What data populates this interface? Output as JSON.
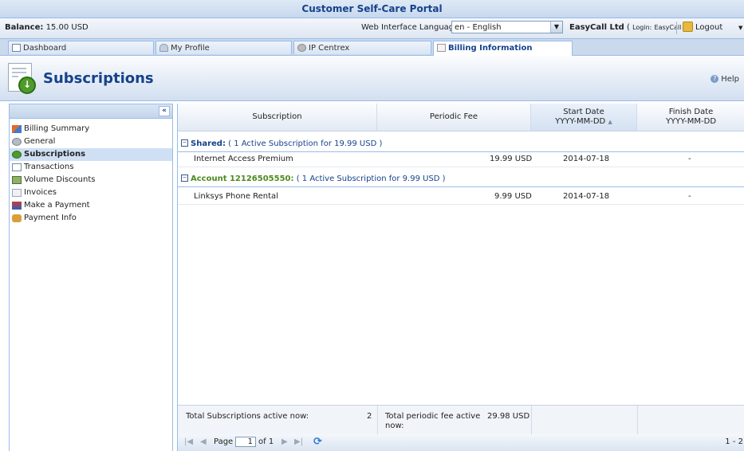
{
  "app": {
    "title": "Customer Self-Care Portal"
  },
  "info": {
    "balance_label": "Balance:",
    "balance_value": "15.00 USD",
    "language_label": "Web Interface Language:",
    "language_value": "en - English",
    "account_name": "EasyCall Ltd",
    "login_label": "Login:",
    "login_value": "EasyCall",
    "logout": "Logout"
  },
  "tabs": [
    {
      "label": "Dashboard",
      "icon": "dashboard-icon"
    },
    {
      "label": "My Profile",
      "icon": "user-icon"
    },
    {
      "label": "IP Centrex",
      "icon": "gear-icon"
    },
    {
      "label": "Billing Information",
      "icon": "document-icon",
      "active": true
    }
  ],
  "header": {
    "title": "Subscriptions",
    "help": "Help"
  },
  "sidebar": {
    "items": [
      {
        "label": "Billing Summary",
        "icon": "chart-icon"
      },
      {
        "label": "General",
        "icon": "gear-icon"
      },
      {
        "label": "Subscriptions",
        "icon": "subscriptions-icon",
        "active": true
      },
      {
        "label": "Transactions",
        "icon": "list-icon"
      },
      {
        "label": "Volume Discounts",
        "icon": "discount-icon"
      },
      {
        "label": "Invoices",
        "icon": "invoice-icon"
      },
      {
        "label": "Make a Payment",
        "icon": "payment-icon"
      },
      {
        "label": "Payment Info",
        "icon": "payment-info-icon"
      }
    ]
  },
  "grid": {
    "columns": {
      "subscription": "Subscription",
      "periodic_fee": "Periodic Fee",
      "start_date": "Start Date",
      "start_date_fmt": "YYYY-MM-DD",
      "finish_date": "Finish Date",
      "finish_date_fmt": "YYYY-MM-DD"
    },
    "groups": [
      {
        "title": "Shared:",
        "summary": "( 1 Active Subscription for 19.99 USD )",
        "rows": [
          {
            "subscription": "Internet Access Premium",
            "fee": "19.99 USD",
            "start": "2014-07-18",
            "finish": "-"
          }
        ]
      },
      {
        "title": "Account 12126505550:",
        "summary": "( 1 Active Subscription for 9.99 USD )",
        "rows": [
          {
            "subscription": "Linksys Phone Rental",
            "fee": "9.99 USD",
            "start": "2014-07-18",
            "finish": "-"
          }
        ]
      }
    ],
    "summary": {
      "active_label": "Total Subscriptions active now:",
      "active_value": "2",
      "fee_label_1": "Total periodic fee active",
      "fee_label_2": "now:",
      "fee_value": "29.98 USD"
    },
    "pager": {
      "page_label": "Page",
      "page_value": "1",
      "of_label": "of 1",
      "range": "1 - 2"
    }
  }
}
